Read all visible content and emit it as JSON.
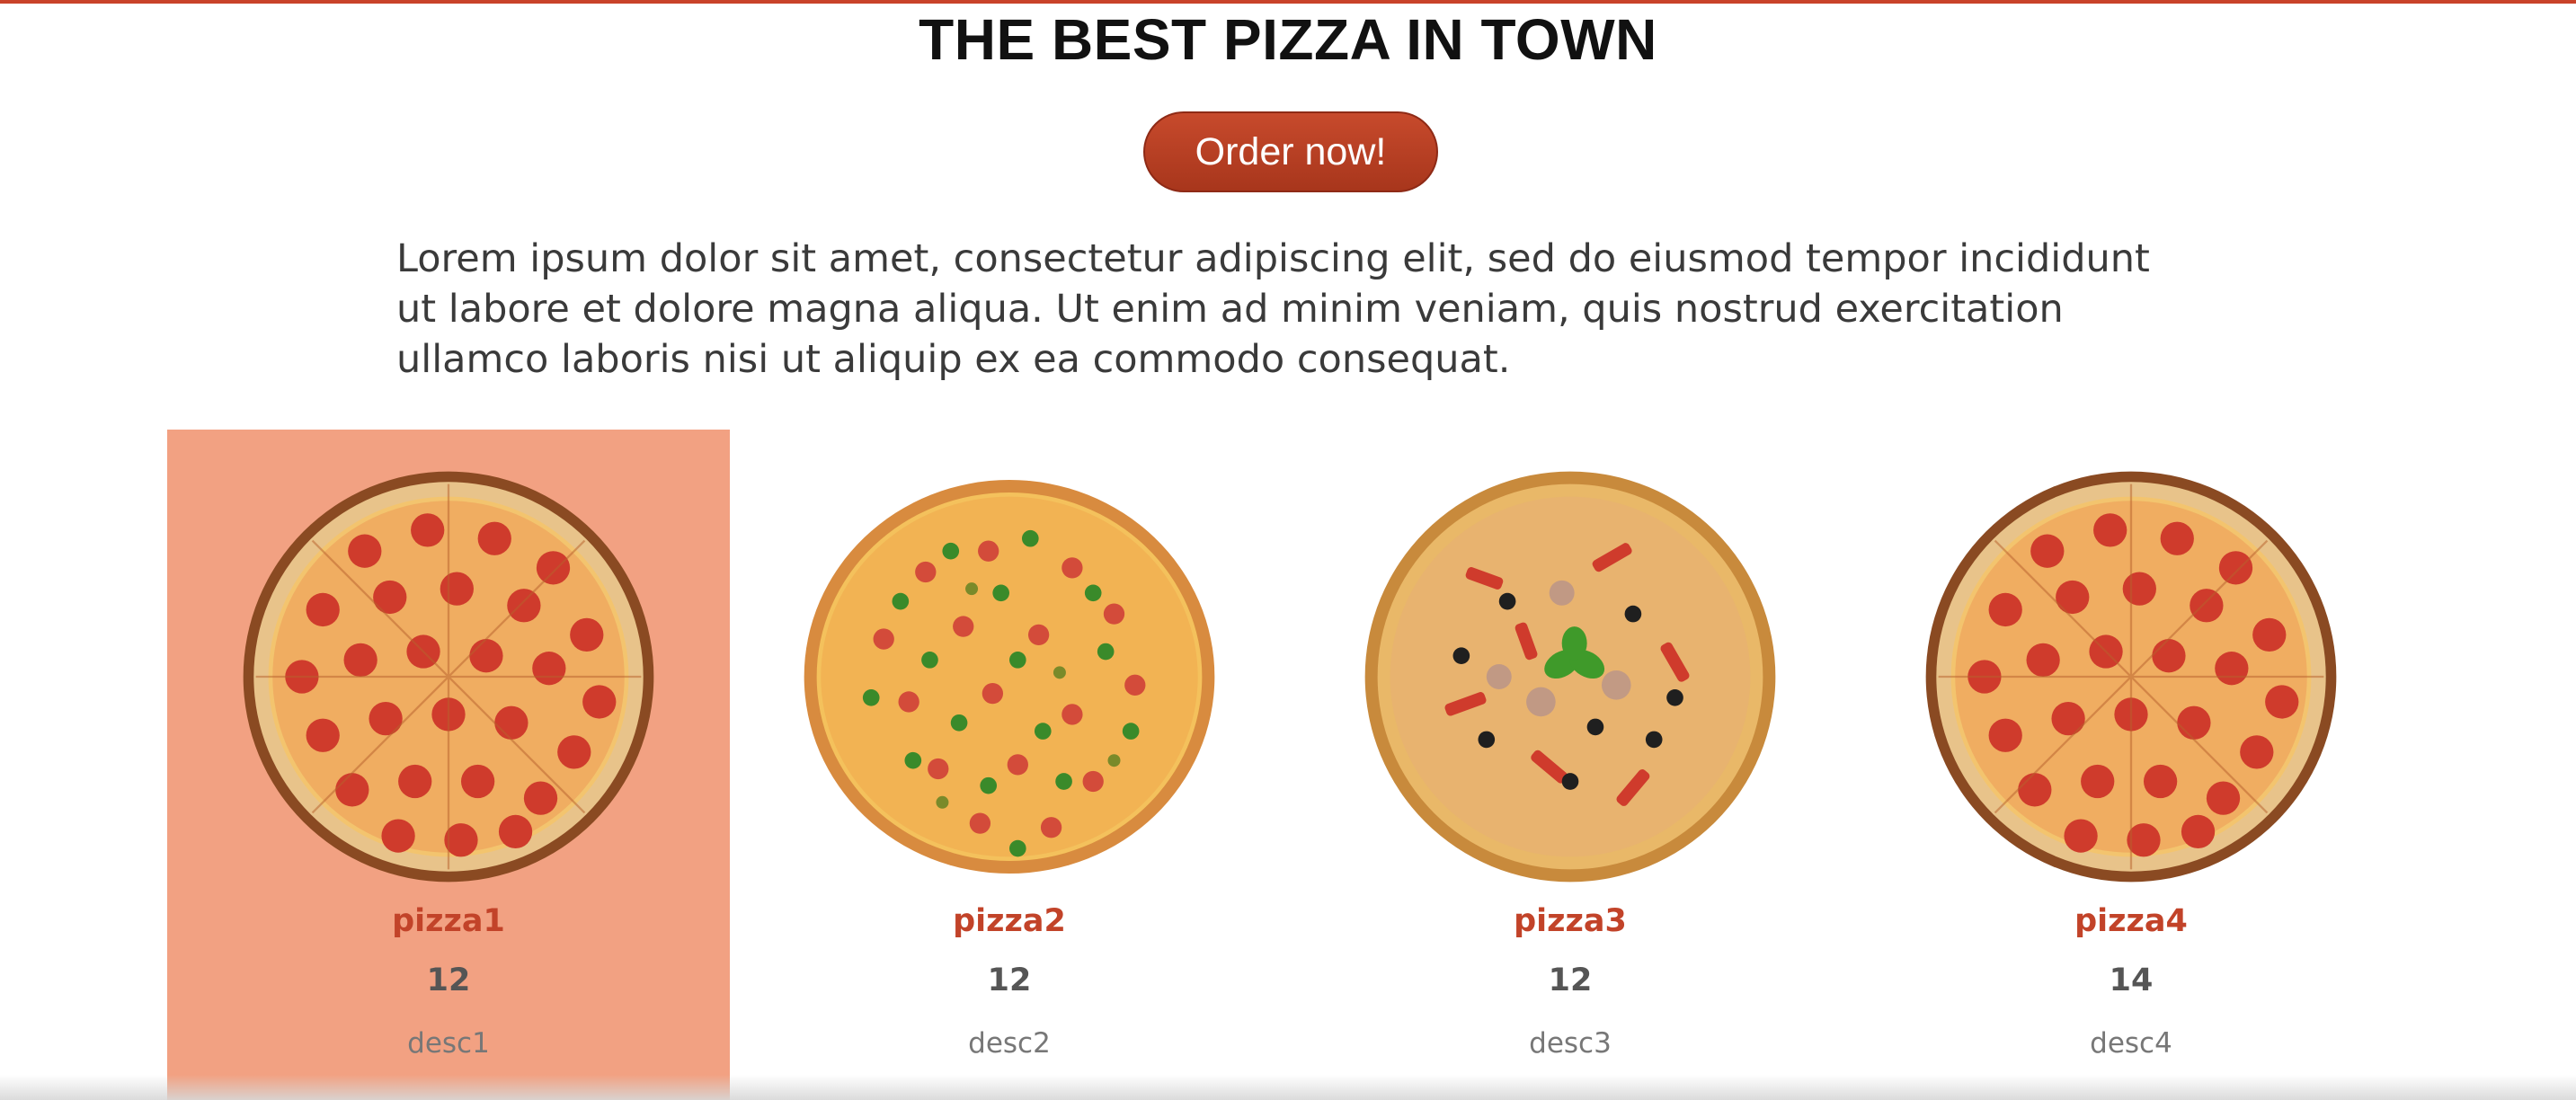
{
  "header": {
    "title": "THE BEST PIZZA IN TOWN",
    "order_button_label": "Order now!",
    "intro_text": "Lorem ipsum dolor sit amet, consectetur adipiscing elit, sed do eiusmod tempor incididunt ut labore et dolore magna aliqua. Ut enim ad minim veniam, quis nostrud exercitation ullamco laboris nisi ut aliquip ex ea commodo consequat."
  },
  "colors": {
    "accent": "#c24329",
    "button": "#b23d22",
    "active_card": "#f2a182",
    "top_rule": "#c9432a"
  },
  "menu": {
    "items": [
      {
        "name": "pizza1",
        "price": "12",
        "description": "desc1",
        "image": "pepperoni-pizza-image",
        "active": true
      },
      {
        "name": "pizza2",
        "price": "12",
        "description": "desc2",
        "image": "sausage-herb-pizza-image",
        "active": false
      },
      {
        "name": "pizza3",
        "price": "12",
        "description": "desc3",
        "image": "supreme-pizza-image",
        "active": false
      },
      {
        "name": "pizza4",
        "price": "14",
        "description": "desc4",
        "image": "pepperoni-pizza-image",
        "active": false
      }
    ]
  }
}
